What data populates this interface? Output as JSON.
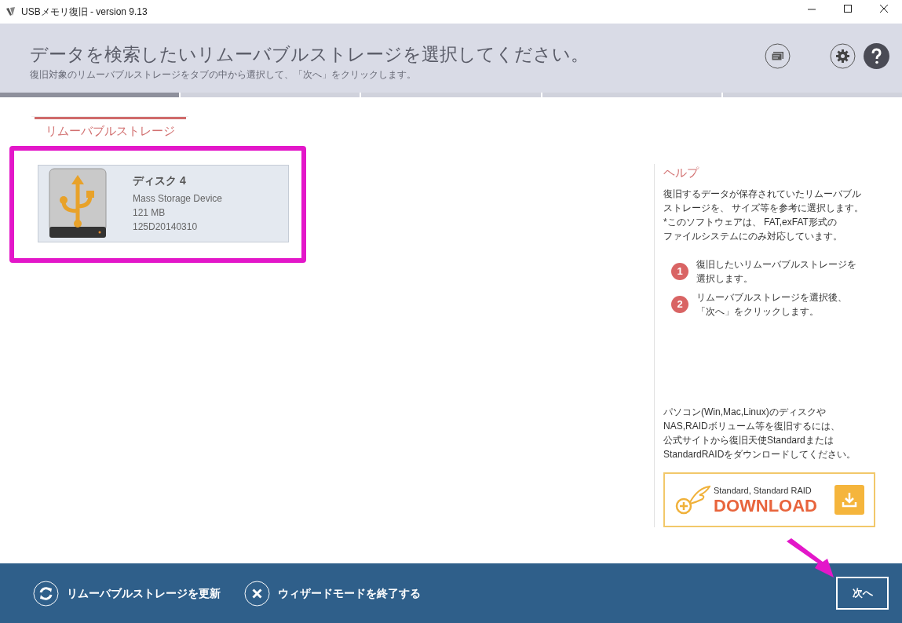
{
  "window": {
    "title": "USBメモリ復旧 - version 9.13"
  },
  "header": {
    "title": "データを検索したいリムーバブルストレージを選択してください。",
    "subtitle": "復旧対象のリムーバブルストレージをタブの中から選択して、「次へ」をクリックします。"
  },
  "wizard_steps": [
    {
      "done": true
    },
    {
      "done": false
    },
    {
      "done": false
    },
    {
      "done": false
    },
    {
      "done": false
    }
  ],
  "tabs": [
    {
      "label": "リムーバブルストレージ",
      "selected": true
    }
  ],
  "devices": [
    {
      "name": "ディスク 4",
      "type": "Mass Storage Device",
      "size": "121 MB",
      "serial": "125D20140310"
    }
  ],
  "help": {
    "title": "ヘルプ",
    "text": [
      "復旧するデータが保存されていたリムーバブル",
      "ストレージを、 サイズ等を参考に選択します。",
      "*このソフトウェアは、 FAT,exFAT形式の",
      "ファイルシステムにのみ対応しています。"
    ],
    "steps": [
      {
        "number": "1",
        "text": [
          "復旧したいリムーバブルストレージを",
          "選択します。"
        ]
      },
      {
        "number": "2",
        "text": [
          "リムーバブルストレージを選択後、",
          "「次へ」をクリックします。"
        ]
      }
    ],
    "note": [
      "パソコン(Win,Mac,Linux)のディスクや",
      "NAS,RAIDボリューム等を復旧するには、",
      "公式サイトから復旧天使Standardまたは",
      "StandardRAIDをダウンロードしてください。"
    ],
    "download": {
      "caption": "Standard, Standard RAID",
      "label": "DOWNLOAD"
    }
  },
  "footer": {
    "refresh": "リムーバブルストレージを更新",
    "exit": "ウィザードモードを終了する",
    "next": "次へ"
  }
}
